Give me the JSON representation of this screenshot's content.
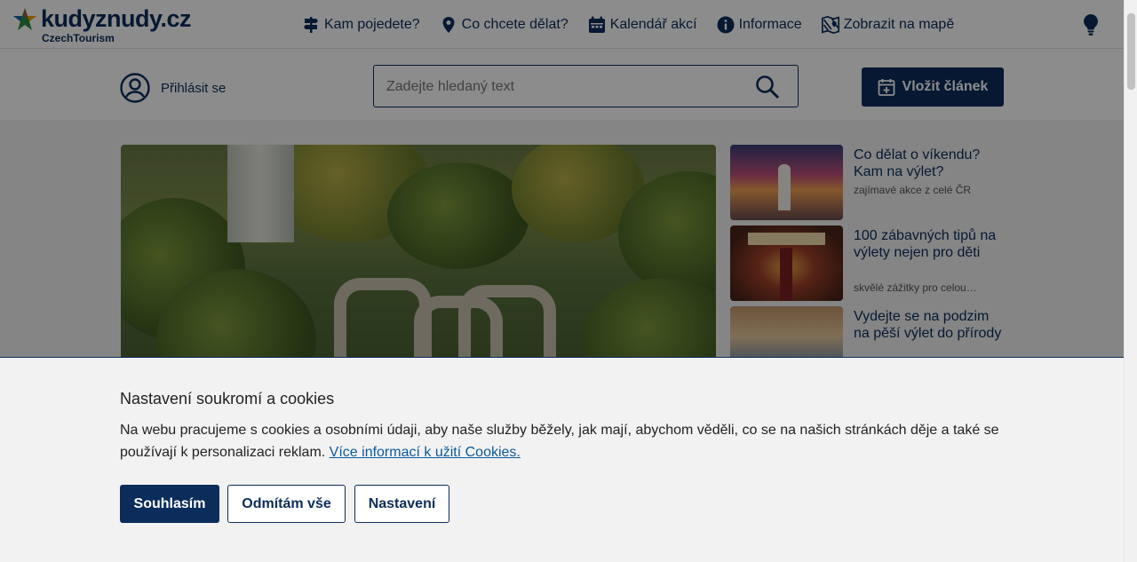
{
  "header": {
    "logo": {
      "name": "kudyznudy.cz",
      "sub": "CzechTourism"
    },
    "nav": [
      {
        "label": "Kam pojedete?",
        "icon": "signpost-icon"
      },
      {
        "label": "Co chcete dělat?",
        "icon": "map-pin-icon"
      },
      {
        "label": "Kalendář akcí",
        "icon": "calendar-icon"
      },
      {
        "label": "Informace",
        "icon": "info-icon"
      },
      {
        "label": "Zobrazit na mapě",
        "icon": "map-icon"
      }
    ],
    "tip_icon": "lightbulb-icon"
  },
  "toolbar": {
    "login_label": "Přihlásit se",
    "search_placeholder": "Zadejte hledaný text",
    "add_article_label": "Vložit článek"
  },
  "sidebar": {
    "items": [
      {
        "title": "Co dělat o víkendu? Kam na výlet?",
        "subtitle": "zajímavé akce z celé ČR"
      },
      {
        "title": "100 zábavných tipů na výlety nejen pro děti",
        "subtitle": "skvělé zážitky pro celou…"
      },
      {
        "title": "Vydejte se na podzim na pěší výlet do přírody",
        "subtitle": ""
      }
    ]
  },
  "cookie": {
    "title": "Nastavení soukromí a cookies",
    "text": "Na webu pracujeme s cookies a osobními údaji, aby naše služby běžely, jak mají, abychom věděli, co se na našich stránkách děje a také se používají k personalizaci reklam.",
    "link": "Více informací k užití Cookies.",
    "accept": "Souhlasím",
    "reject": "Odmítám vše",
    "settings": "Nastavení"
  },
  "colors": {
    "brand": "#0c2d5b",
    "link": "#0c5a9e"
  }
}
